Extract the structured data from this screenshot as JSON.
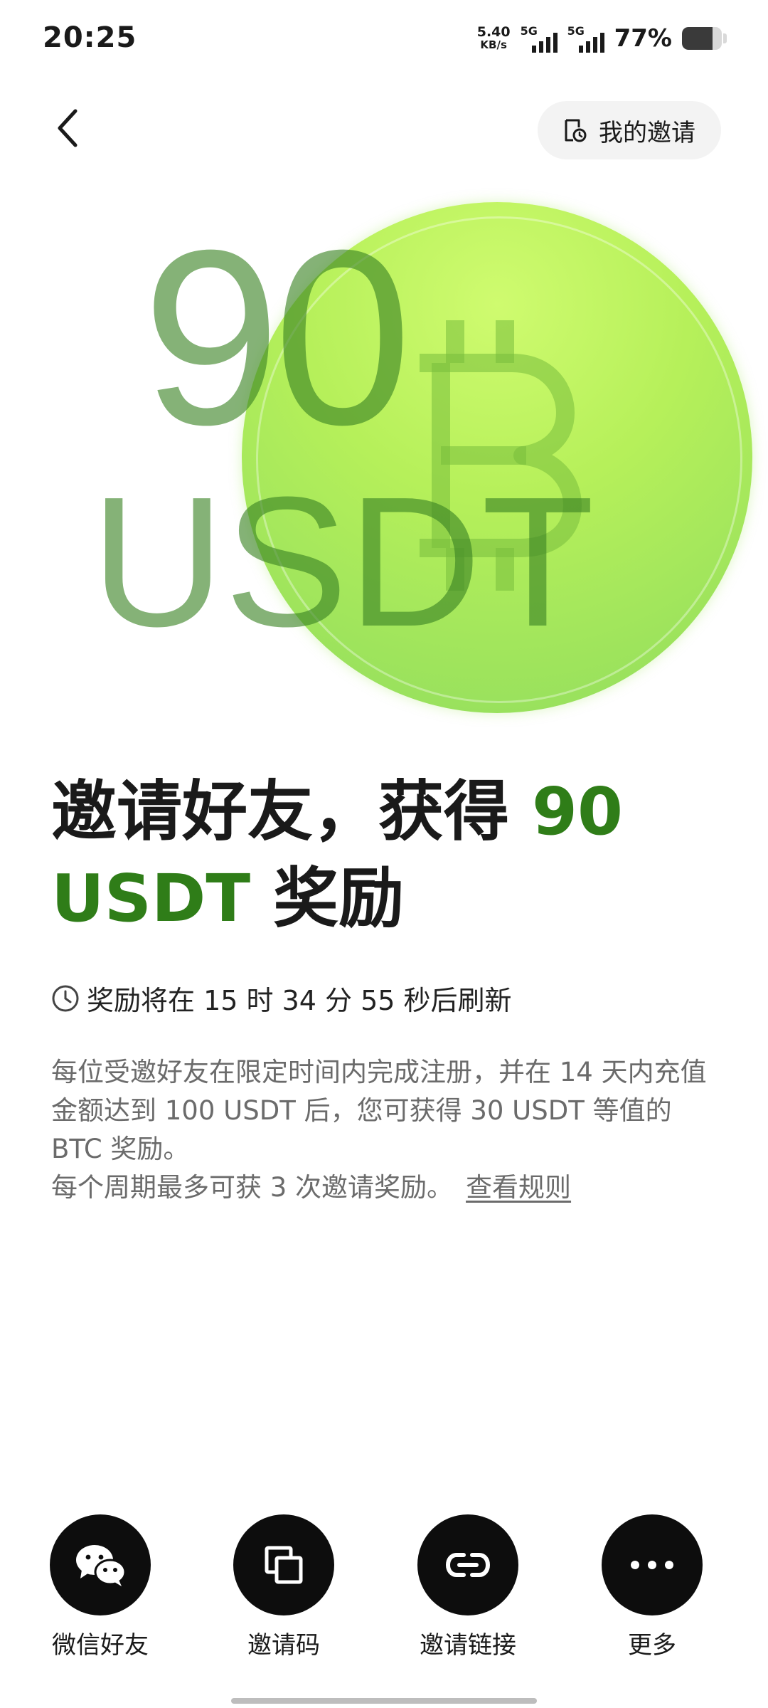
{
  "status_bar": {
    "time": "20:25",
    "net_speed_value": "5.40",
    "net_speed_unit": "KB/s",
    "signal_1_label": "5G",
    "signal_2_label": "5G",
    "battery_percent": "77%",
    "battery_level": 0.77
  },
  "nav": {
    "my_invite_label": "我的邀请"
  },
  "hero": {
    "amount": "90",
    "unit": "USDT"
  },
  "headline": {
    "part1": "邀请好友，获得 ",
    "accent1": "90",
    "accent2": "USDT",
    "part2": " 奖励"
  },
  "countdown": {
    "text": "奖励将在 15 时 34 分 55 秒后刷新"
  },
  "description": {
    "paragraph": "每位受邀好友在限定时间内完成注册，并在 14 天内充值金额达到 100 USDT 后，您可获得 30 USDT 等值的 BTC 奖励。",
    "limit_text": "每个周期最多可获 3 次邀请奖励。",
    "rules_link": "查看规则"
  },
  "share": {
    "items": [
      {
        "label": "微信好友",
        "icon": "wechat-icon"
      },
      {
        "label": "邀请码",
        "icon": "copy-icon"
      },
      {
        "label": "邀请链接",
        "icon": "link-icon"
      },
      {
        "label": "更多",
        "icon": "more-icon"
      }
    ]
  },
  "colors": {
    "accent": "#2f7d18",
    "coin": "#b6f05a",
    "share_button": "#0d0d0d"
  }
}
